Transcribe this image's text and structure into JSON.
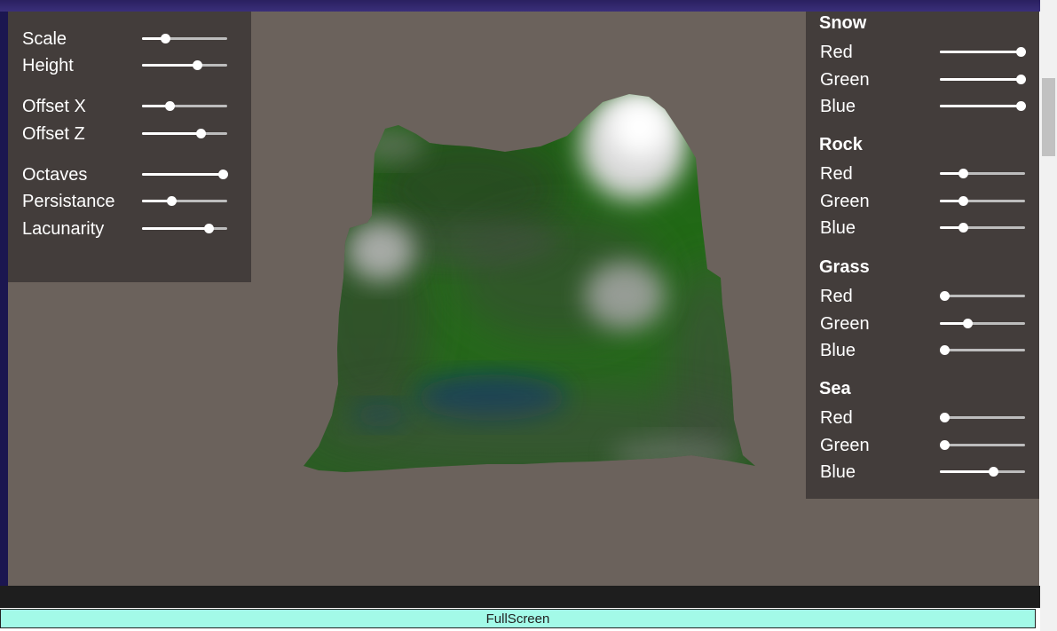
{
  "left_controls": [
    {
      "label": "Scale",
      "value": 0.27
    },
    {
      "label": "Height",
      "value": 0.65
    },
    {
      "label": "Offset X",
      "value": 0.32
    },
    {
      "label": "Offset Z",
      "value": 0.69
    },
    {
      "label": "Octaves",
      "value": 0.95
    },
    {
      "label": "Persistance",
      "value": 0.34
    },
    {
      "label": "Lacunarity",
      "value": 0.78
    }
  ],
  "color_groups": [
    {
      "title": "Snow",
      "sliders": [
        {
          "label": "Red",
          "value": 0.95
        },
        {
          "label": "Green",
          "value": 0.95
        },
        {
          "label": "Blue",
          "value": 0.95
        }
      ]
    },
    {
      "title": "Rock",
      "sliders": [
        {
          "label": "Red",
          "value": 0.27
        },
        {
          "label": "Green",
          "value": 0.27
        },
        {
          "label": "Blue",
          "value": 0.27
        }
      ]
    },
    {
      "title": "Grass",
      "sliders": [
        {
          "label": "Red",
          "value": 0.05
        },
        {
          "label": "Green",
          "value": 0.32
        },
        {
          "label": "Blue",
          "value": 0.05
        }
      ]
    },
    {
      "title": "Sea",
      "sliders": [
        {
          "label": "Red",
          "value": 0.05
        },
        {
          "label": "Green",
          "value": 0.05
        },
        {
          "label": "Blue",
          "value": 0.62
        }
      ]
    }
  ],
  "footer": {
    "fullscreen_label": "FullScreen"
  },
  "colors": {
    "background": "#6b625c",
    "panel": "#3a3634",
    "grass": "#1f6b12",
    "snow": "#ffffff",
    "sea": "#0d3f5a",
    "button": "#a3fae8"
  }
}
